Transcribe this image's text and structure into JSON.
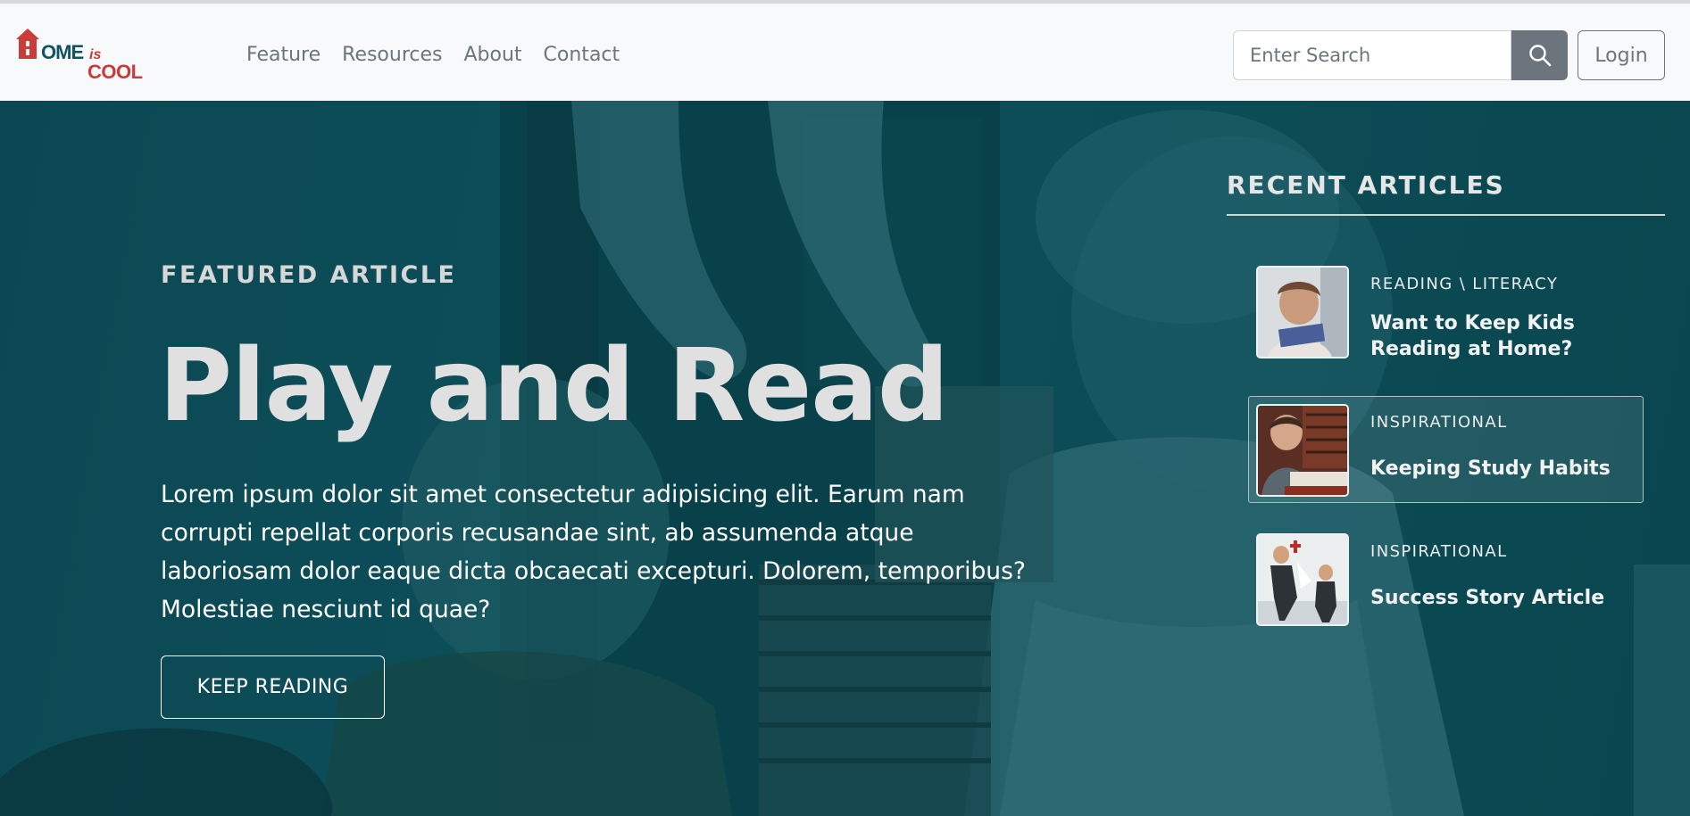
{
  "brand": {
    "logo_home": "OME",
    "logo_is": "is",
    "logo_cool": "COOL"
  },
  "nav": {
    "links": [
      "Feature",
      "Resources",
      "About",
      "Contact"
    ]
  },
  "search": {
    "placeholder": "Enter Search",
    "button_icon": "search-icon"
  },
  "auth": {
    "login_label": "Login"
  },
  "featured": {
    "eyebrow": "FEATURED ARTICLE",
    "headline": "Play and Read",
    "body": "Lorem ipsum dolor sit amet consectetur adipisicing elit. Earum nam corrupti repellat corporis recusandae sint, ab assumenda atque laboriosam dolor eaque dicta obcaecati excepturi. Dolorem, temporibus? Molestiae nesciunt id quae?",
    "cta_label": "KEEP READING"
  },
  "recent": {
    "title": "RECENT ARTICLES",
    "articles": [
      {
        "category": "READING \\ LITERACY",
        "title": "Want to Keep Kids Reading at Home?",
        "active": false
      },
      {
        "category": "INSPIRATIONAL",
        "title": "Keeping Study Habits",
        "active": true
      },
      {
        "category": "INSPIRATIONAL",
        "title": "Success Story Article",
        "active": false
      }
    ]
  },
  "colors": {
    "hero_teal": "#0f5560",
    "brand_red": "#cc3b3b",
    "brand_teal": "#0f5560",
    "nav_gray": "#6c757d"
  }
}
